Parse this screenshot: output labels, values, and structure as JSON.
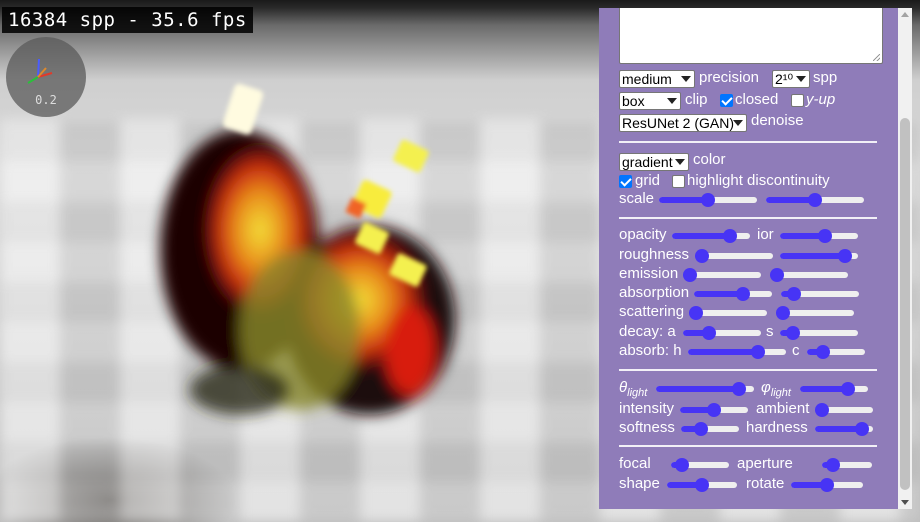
{
  "overlay": {
    "fps_text": "16384 spp - 35.6 fps",
    "gizmo_scale": "0.2",
    "gizmo_icon": "axis-gizmo-icon"
  },
  "panel": {
    "precision": {
      "value": "medium",
      "label": "precision"
    },
    "spp": {
      "value": "2¹⁰",
      "label": "spp"
    },
    "clip": {
      "value": "box",
      "label": "clip"
    },
    "closed": {
      "label": "closed",
      "checked": true
    },
    "yup": {
      "label": "y-up",
      "checked": false
    },
    "denoise": {
      "value": "ResUNet 2 (GAN)",
      "label": "denoise"
    },
    "color": {
      "value": "gradient",
      "label": "color"
    },
    "grid": {
      "label": "grid",
      "checked": true
    },
    "highlight": {
      "label": "highlight discontinuity",
      "checked": false
    },
    "scale": {
      "label": "scale",
      "values": [
        0.5,
        0.5
      ]
    },
    "opacity": {
      "label": "opacity",
      "value": 0.8
    },
    "ior": {
      "label": "ior",
      "value": 0.6
    },
    "roughness": {
      "label": "roughness",
      "values": [
        0.0,
        0.9
      ]
    },
    "emission": {
      "label": "emission",
      "values": [
        0.0,
        0.0
      ]
    },
    "absorption": {
      "label": "absorption",
      "values": [
        0.65,
        0.1
      ]
    },
    "scattering": {
      "label": "scattering",
      "values": [
        0.0,
        0.0
      ]
    },
    "decay_a": {
      "label": "decay: a",
      "value": 0.3
    },
    "decay_s": {
      "label": "s",
      "value": 0.1
    },
    "absorb_h": {
      "label": "absorb: h",
      "value": 0.75
    },
    "absorb_c": {
      "label": "c",
      "value": 0.2
    },
    "theta_light": {
      "label_main": "θ",
      "label_sub": "light",
      "value": 0.9
    },
    "phi_light": {
      "label_main": "φ",
      "label_sub": "light",
      "value": 0.75
    },
    "intensity": {
      "label": "intensity",
      "value": 0.5
    },
    "ambient": {
      "label": "ambient",
      "value": 0.0
    },
    "softness": {
      "label": "softness",
      "value": 0.3
    },
    "hardness": {
      "label": "hardness",
      "value": 0.9
    },
    "focal": {
      "label": "focal",
      "value": 0.1
    },
    "aperture": {
      "label": "aperture",
      "value": 0.1
    },
    "shape": {
      "label": "shape",
      "value": 0.5
    },
    "rotate": {
      "label": "rotate",
      "value": 0.5
    }
  }
}
